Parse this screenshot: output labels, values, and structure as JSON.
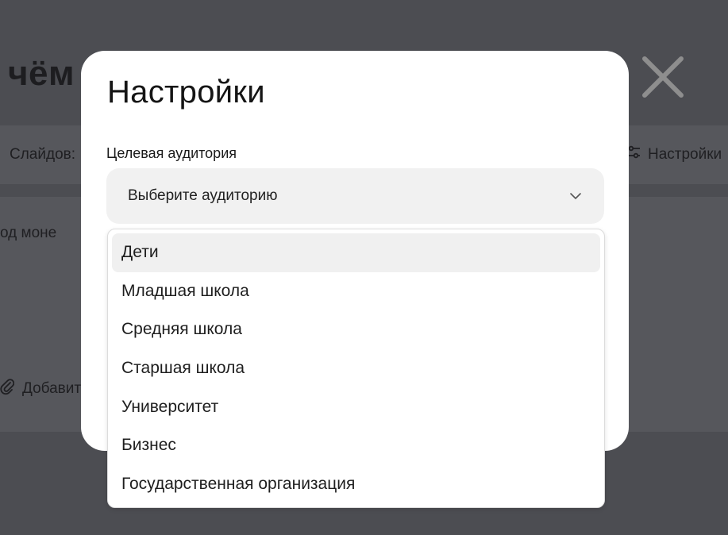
{
  "background": {
    "title_partial": "чём",
    "slides_label": "Слайдов:",
    "settings_label": "Настройки",
    "topic_partial": "од моне",
    "attach_partial": "Добавить"
  },
  "modal": {
    "title": "Настройки",
    "audience": {
      "label": "Целевая аудитория",
      "placeholder": "Выберите аудиторию",
      "options": [
        "Дети",
        "Младшая школа",
        "Средняя школа",
        "Старшая школа",
        "Университет",
        "Бизнес",
        "Государственная организация"
      ],
      "highlighted_option": "Дети"
    }
  },
  "icons": {
    "close": "close-icon",
    "chevron": "chevron-down-icon",
    "settings": "sliders-icon",
    "attach": "paperclip-icon"
  },
  "colors": {
    "overlay": "#4c4d52",
    "modal_bg": "#ffffff",
    "select_bg": "#f1f1f1",
    "option_hover": "#f0f0f0",
    "close_icon": "#8e8e8e"
  }
}
